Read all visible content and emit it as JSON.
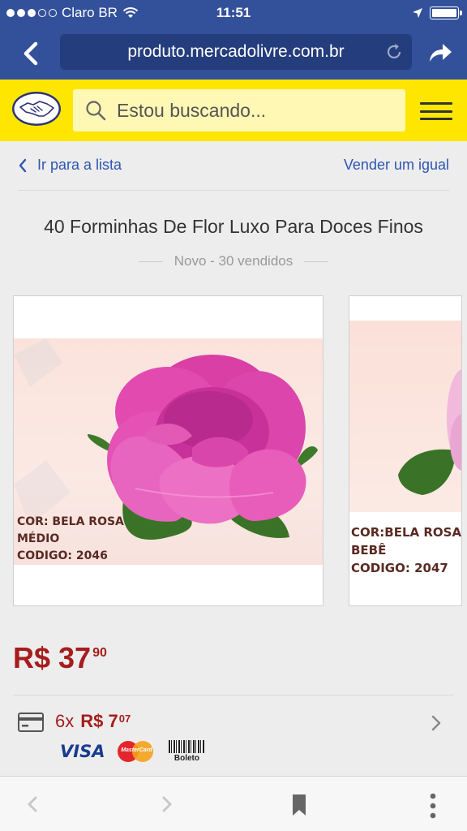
{
  "status_bar": {
    "carrier": "Claro BR",
    "time": "11:51"
  },
  "browser": {
    "url": "produto.mercadolivre.com.br"
  },
  "header": {
    "search_placeholder": "Estou buscando..."
  },
  "nav": {
    "back_to_list": "Ir para a lista",
    "sell_similar": "Vender um igual"
  },
  "product": {
    "title": "40 Forminhas De Flor Luxo Para Doces Finos",
    "condition": "Novo - 30 vendidos",
    "images": [
      {
        "caption_lines": [
          "COR: BELA ROSA",
          "MÉDIO",
          "CODIGO: 2046"
        ]
      },
      {
        "caption_lines": [
          "COR:BELA ROSA",
          "BEBÊ",
          "CODIGO: 2047"
        ]
      }
    ],
    "price": {
      "main": "R$ 37",
      "cents": "90"
    },
    "installments": {
      "count": "6x",
      "amount": "R$ 7",
      "cents": "07"
    },
    "payment_methods": {
      "visa": "VISA",
      "mastercard": "MasterCard",
      "boleto": "Boleto"
    }
  },
  "colors": {
    "status_bar": "#33509a",
    "url_box": "#243d7d",
    "brand_yellow": "#ffe600",
    "link_blue": "#2d56b2",
    "price_red": "#a61d1d"
  },
  "icons": [
    "back-arrow-icon",
    "reload-icon",
    "share-icon",
    "mercadolivre-handshake-logo",
    "search-icon",
    "hamburger-menu-icon",
    "chevron-left-icon",
    "credit-card-icon",
    "chevron-right-icon",
    "bookmark-icon",
    "more-vertical-icon"
  ]
}
